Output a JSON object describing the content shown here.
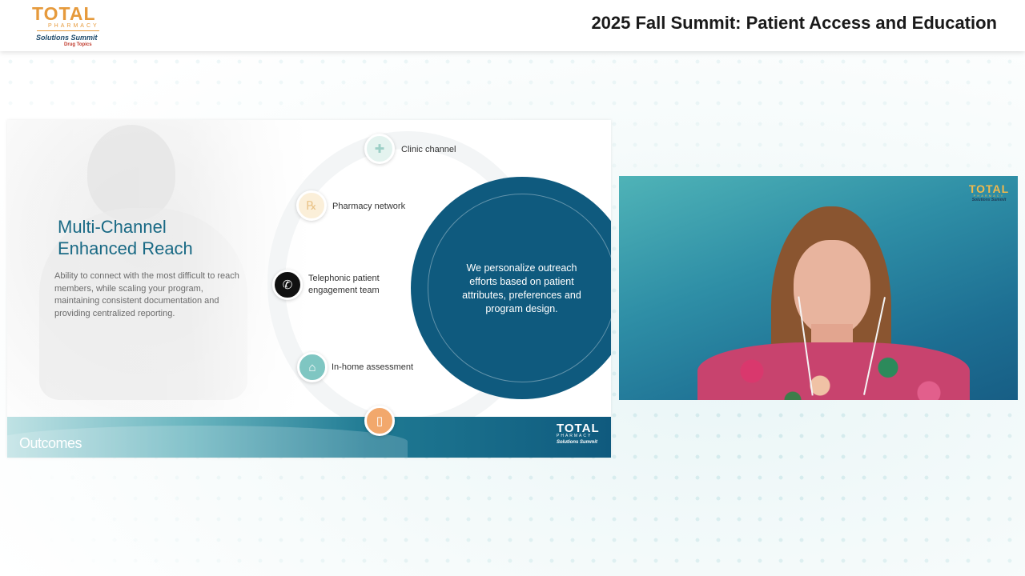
{
  "header": {
    "title": "2025 Fall Summit: Patient Access and Education",
    "logo": {
      "word": "TOTAL",
      "sub": "PHARMACY",
      "tagline": "Solutions Summit",
      "powered": "Drug Topics"
    }
  },
  "slide": {
    "title_line1": "Multi-Channel",
    "title_line2": "Enhanced Reach",
    "description": "Ability to connect with the most difficult to reach members, while scaling your program, maintaining consistent documentation and providing centralized reporting.",
    "channels": [
      {
        "label": "Clinic channel",
        "icon": "clinic-icon",
        "color": "#e4f3ef"
      },
      {
        "label": "Pharmacy network",
        "icon": "pharmacy-icon",
        "color": "#fbefd9"
      },
      {
        "label": "Telephonic patient",
        "label2": "engagement team",
        "icon": "phone-icon",
        "color": "#111111"
      },
      {
        "label": "In-home assessment",
        "icon": "home-icon",
        "color": "#7fc6c2"
      },
      {
        "label": "",
        "icon": "mobile-icon",
        "color": "#f2a86c"
      }
    ],
    "center_text": "We personalize outreach efforts based on patient attributes, preferences and program design.",
    "footer_brand": "Outcomes",
    "footer_logo": {
      "word": "TOTAL",
      "sub": "PHARMACY",
      "tagline": "Solutions Summit"
    }
  },
  "webcam": {
    "logo": {
      "word": "TOTAL",
      "sub": "PHARMACY",
      "tagline": "Solutions Summit"
    }
  },
  "colors": {
    "brand_orange": "#e69a3c",
    "slide_blue": "#0f5a7e",
    "title_teal": "#1a6a85"
  }
}
